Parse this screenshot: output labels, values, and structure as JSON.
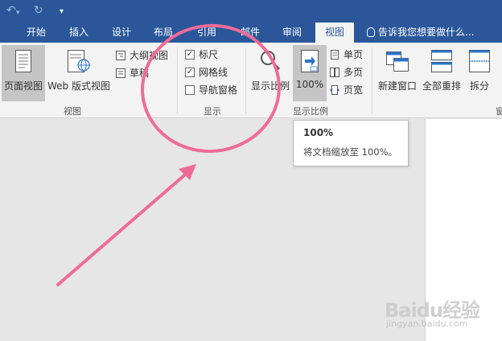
{
  "qat": {
    "undo_icon": "undo-icon",
    "redo_icon": "redo-icon",
    "customize_icon": "customize-qat-icon"
  },
  "tabs": [
    {
      "label": "开始"
    },
    {
      "label": "插入"
    },
    {
      "label": "设计"
    },
    {
      "label": "布局"
    },
    {
      "label": "引用"
    },
    {
      "label": "邮件"
    },
    {
      "label": "审阅"
    },
    {
      "label": "视图",
      "active": true
    }
  ],
  "tell_me": "告诉我您想要做什么...",
  "ribbon": {
    "views": {
      "group_label": "视图",
      "print_layout": "页面视图",
      "web_layout": "Web 版式视图",
      "outline": "大纲视图",
      "draft": "草稿"
    },
    "show": {
      "group_label": "显示",
      "ruler": {
        "label": "标尺",
        "checked": true
      },
      "gridlines": {
        "label": "网格线",
        "checked": true
      },
      "nav_pane": {
        "label": "导航窗格",
        "checked": false
      }
    },
    "zoom": {
      "group_label": "显示比例",
      "zoom": "显示比例",
      "hundred": "100%",
      "one_page": "单页",
      "multi_page": "多页",
      "page_width": "页宽"
    },
    "window": {
      "new_window": "新建窗口",
      "arrange_all": "全部重排",
      "split": "拆分",
      "group_label_partial": "窗"
    }
  },
  "tooltip": {
    "title": "100%",
    "description": "将文档缩放至 100%。"
  },
  "watermark": {
    "text": "Baidu经验",
    "sub": "jingyan.baidu.com"
  },
  "colors": {
    "title_bar": "#2b579a",
    "ribbon_bg": "#f3f3f3",
    "annotation": "#ef6b97"
  }
}
